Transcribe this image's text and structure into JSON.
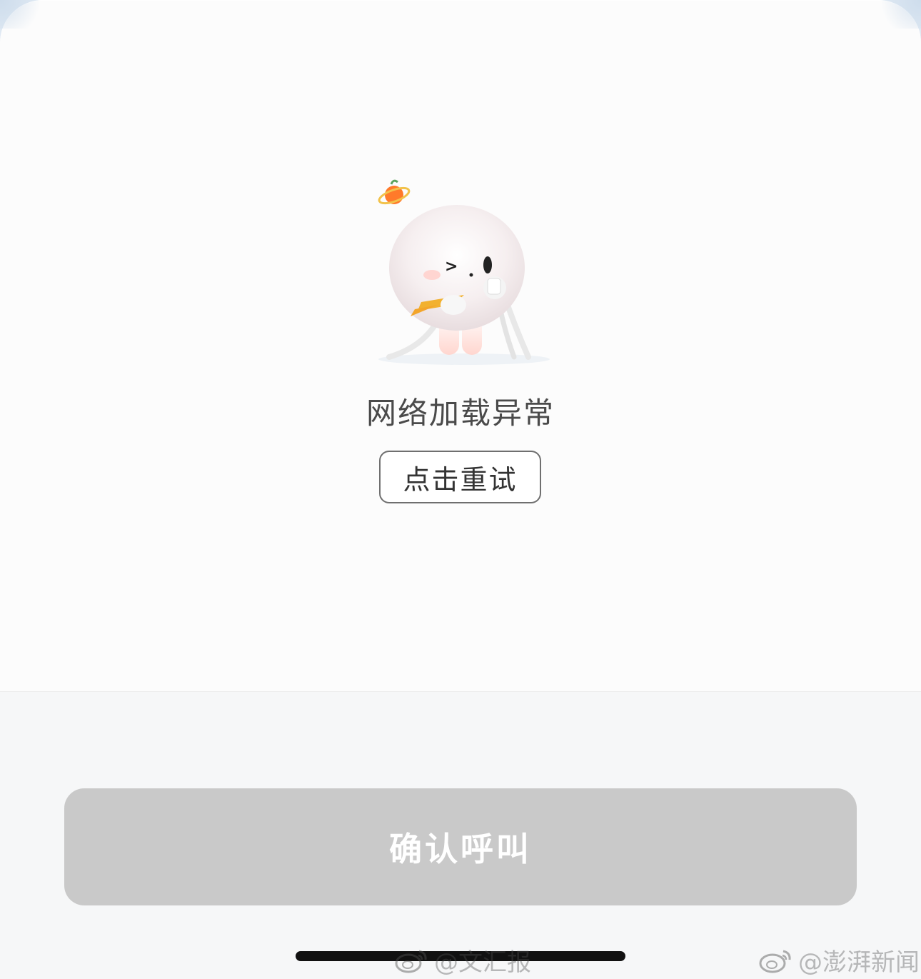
{
  "error_state": {
    "message": "网络加载异常",
    "retry_label": "点击重试"
  },
  "action": {
    "confirm_label": "确认呼叫",
    "disabled": true
  },
  "watermarks": [
    {
      "text": "@文汇报",
      "icon": "weibo-icon"
    },
    {
      "text": "@澎湃新闻",
      "icon": "weibo-icon"
    }
  ],
  "colors": {
    "accent": "#ff8a2a",
    "button_disabled": "#c9c9c9",
    "text": "#4a4a4a"
  }
}
